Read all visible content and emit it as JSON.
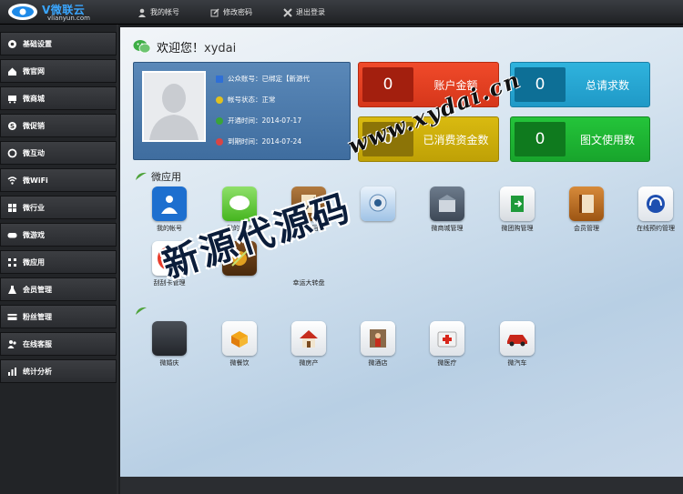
{
  "header": {
    "logo": {
      "brand": "V微联云",
      "domain": "vlianyun.com"
    },
    "nav": [
      {
        "label": "我的帐号",
        "icon": "user-icon"
      },
      {
        "label": "修改密码",
        "icon": "edit-icon"
      },
      {
        "label": "退出登录",
        "icon": "close-icon"
      }
    ]
  },
  "sidebar": {
    "items": [
      {
        "label": "基础设置",
        "icon": "gear-icon"
      },
      {
        "label": "微官网",
        "icon": "home-icon"
      },
      {
        "label": "微商城",
        "icon": "cart-icon"
      },
      {
        "label": "微促销",
        "icon": "tag-icon"
      },
      {
        "label": "微互动",
        "icon": "refresh-icon"
      },
      {
        "label": "微WiFi",
        "icon": "wifi-icon"
      },
      {
        "label": "微行业",
        "icon": "grid-icon"
      },
      {
        "label": "微游戏",
        "icon": "gamepad-icon"
      },
      {
        "label": "微应用",
        "icon": "apps-icon"
      },
      {
        "label": "会员管理",
        "icon": "flask-icon"
      },
      {
        "label": "粉丝管理",
        "icon": "card-icon"
      },
      {
        "label": "在线客服",
        "icon": "people-icon"
      },
      {
        "label": "统计分析",
        "icon": "chart-icon"
      }
    ]
  },
  "welcome": {
    "greeting": "欢迎您！",
    "username": "xydai"
  },
  "profile": {
    "rows": [
      {
        "text": "公众账号：已绑定【新源代",
        "color": "#2f6fd6"
      },
      {
        "text": "帐号状态：正常",
        "color": "#e0c120"
      },
      {
        "text": "开通时间：2014-07-17",
        "color": "#3aa33a"
      },
      {
        "text": "到期时间：2014-07-24",
        "color": "#d84545"
      }
    ]
  },
  "stats": [
    {
      "value": "0",
      "label": "账户金额"
    },
    {
      "value": "0",
      "label": "总请求数"
    },
    {
      "value": "0",
      "label": "已消费资金数"
    },
    {
      "value": "0",
      "label": "图文使用数"
    }
  ],
  "sections": {
    "apps_title": "微应用"
  },
  "apps": [
    {
      "name": "我的帐号",
      "icon": "account-icon"
    },
    {
      "name": "我的微信",
      "icon": "chat-bubble-icon"
    },
    {
      "name": "关键词回复",
      "icon": "notebook-pen-icon"
    },
    {
      "name": "",
      "icon": "webcam-icon"
    },
    {
      "name": "微商城管理",
      "icon": "shop-icon"
    },
    {
      "name": "微团购管理",
      "icon": "exit-door-icon"
    },
    {
      "name": "会员管理",
      "icon": "address-book-icon"
    },
    {
      "name": "在线预约管理",
      "icon": "headset-icon"
    },
    {
      "name": "刮刮卡管理",
      "icon": "browser-ring-icon"
    },
    {
      "name": "",
      "icon": "fruit-game-icon"
    },
    {
      "name": "幸运大转盘",
      "icon": ""
    }
  ],
  "industry": [
    {
      "name": "微婚庆",
      "icon": "dark-tile-icon"
    },
    {
      "name": "微餐饮",
      "icon": "food-box-icon"
    },
    {
      "name": "微房产",
      "icon": "house-icon"
    },
    {
      "name": "微酒店",
      "icon": "hotel-person-icon"
    },
    {
      "name": "微医疗",
      "icon": "medical-kit-icon"
    },
    {
      "name": "微汽车",
      "icon": "car-icon"
    }
  ],
  "watermark": {
    "url": "www.xydai.cn",
    "text": "新源代源码"
  }
}
